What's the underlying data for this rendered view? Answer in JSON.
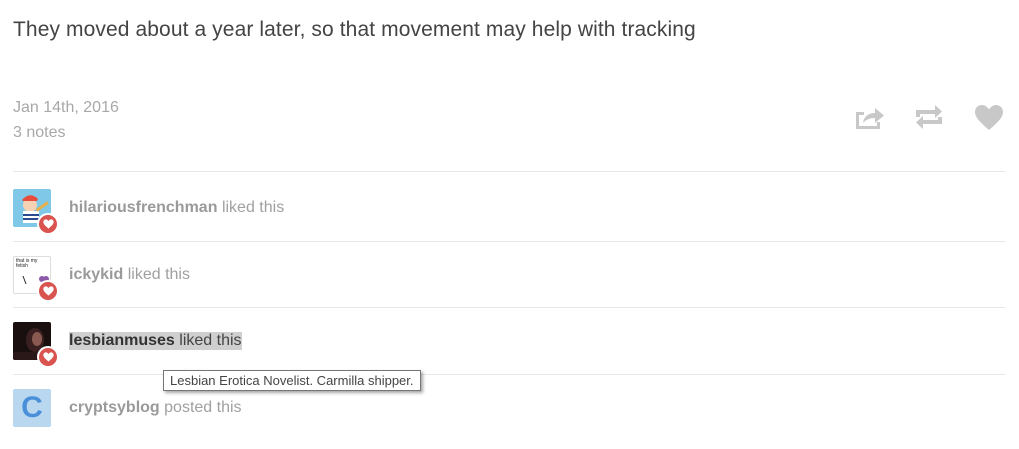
{
  "post": {
    "text": "They moved about a year later, so that movement may help with tracking",
    "date": "Jan 14th, 2016",
    "notes": "3 notes"
  },
  "actions": [
    {
      "icon": "share-icon"
    },
    {
      "icon": "reblog-icon"
    },
    {
      "icon": "heart-icon"
    }
  ],
  "notes": [
    {
      "user": "hilariousfrenchman",
      "action": "liked this",
      "type": "like"
    },
    {
      "user": "ickykid",
      "action": "liked this",
      "type": "like",
      "avatar_text": "that is my fetish"
    },
    {
      "user": "lesbianmuses",
      "action": "liked this",
      "type": "like"
    },
    {
      "user": "cryptsyblog",
      "action": "posted this",
      "type": "post",
      "avatar_letter": "C"
    }
  ],
  "tooltip": {
    "text": "Lesbian Erotica Novelist. Carmilla shipper."
  },
  "colors": {
    "like_badge": "#d9534f",
    "icon_gray": "#c8c8c8",
    "highlight": "#cfcfcf"
  }
}
